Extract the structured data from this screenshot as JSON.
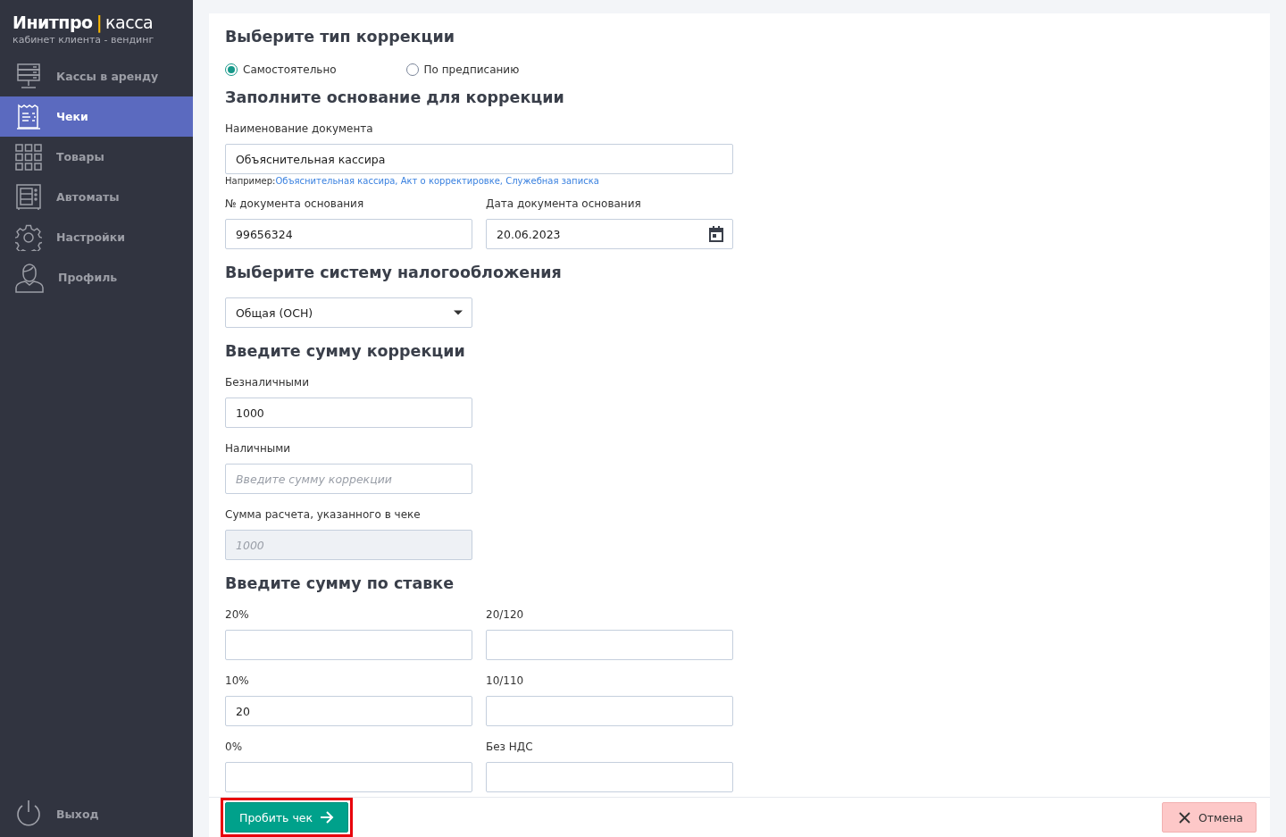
{
  "sidebar": {
    "brand": {
      "name": "Инитпро",
      "separator": "|",
      "product": "касса"
    },
    "subtitle": "кабинет клиента - вендинг",
    "items": [
      {
        "label": "Кассы в аренду",
        "selected": false
      },
      {
        "label": "Чеки",
        "selected": true
      },
      {
        "label": "Товары",
        "selected": false
      },
      {
        "label": "Автоматы",
        "selected": false
      },
      {
        "label": "Настройки",
        "selected": false
      },
      {
        "label": "Профиль",
        "selected": false
      }
    ],
    "logout": {
      "label": "Выход"
    }
  },
  "form": {
    "blocks": [
      {
        "kind": "heading",
        "text": "Выберите тип коррекции"
      },
      {
        "kind": "radios",
        "options": [
          {
            "label": "Самостоятельно",
            "selected": true
          },
          {
            "label": "По предписанию",
            "selected": false
          }
        ]
      },
      {
        "kind": "heading",
        "text": "Заполните основание для коррекции"
      },
      {
        "kind": "fields",
        "fields": [
          {
            "kind": "text",
            "label": "Наименование документа",
            "value": "Объяснительная кассира",
            "disabled": false,
            "hint": {
              "prefix": "Например:",
              "examples": "Объяснительная кассира, Акт о корректировке, Служебная записка"
            }
          }
        ]
      },
      {
        "kind": "fields",
        "fields": [
          {
            "kind": "text",
            "label": "№ документа основания",
            "value": "99656324",
            "disabled": false
          },
          {
            "kind": "date",
            "label": "Дата документа основания",
            "value": "20.06.2023",
            "disabled": false
          }
        ]
      },
      {
        "kind": "heading",
        "text": "Выберите систему налогообложения"
      },
      {
        "kind": "fields",
        "fields": [
          {
            "kind": "select",
            "value": "Общая (ОСН)",
            "disabled": false
          }
        ]
      },
      {
        "kind": "heading",
        "text": "Введите сумму коррекции"
      },
      {
        "kind": "fields",
        "fields": [
          {
            "kind": "text",
            "label": "Безналичными",
            "value": "1000",
            "disabled": false
          }
        ]
      },
      {
        "kind": "fields",
        "fields": [
          {
            "kind": "text",
            "label": "Наличными",
            "placeholder": "Введите сумму коррекции",
            "disabled": false
          }
        ]
      },
      {
        "kind": "fields",
        "fields": [
          {
            "kind": "text",
            "label": "Сумма расчета, указанного в чеке",
            "placeholder": "1000",
            "disabled": true
          }
        ]
      },
      {
        "kind": "heading",
        "text": "Введите сумму по ставке"
      },
      {
        "kind": "fields",
        "fields": [
          {
            "kind": "text",
            "label": "20%",
            "disabled": false
          },
          {
            "kind": "text",
            "label": "20/120",
            "disabled": false
          }
        ]
      },
      {
        "kind": "fields",
        "fields": [
          {
            "kind": "text",
            "label": "10%",
            "value": "20",
            "disabled": false
          },
          {
            "kind": "text",
            "label": "10/110",
            "disabled": false
          }
        ]
      },
      {
        "kind": "fields",
        "fields": [
          {
            "kind": "text",
            "label": "0%",
            "disabled": false
          },
          {
            "kind": "text",
            "label": "Без НДС",
            "disabled": false
          }
        ]
      }
    ]
  },
  "footer": {
    "submit": {
      "label": "Пробить чек",
      "highlighted": true
    },
    "cancel": {
      "label": "Отмена"
    }
  }
}
